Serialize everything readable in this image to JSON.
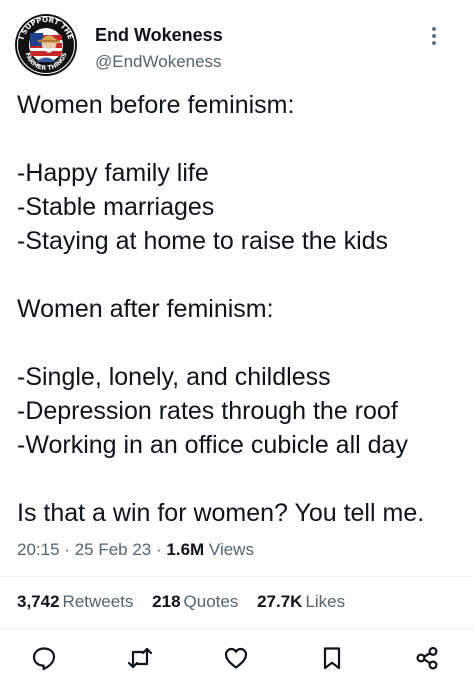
{
  "author": {
    "display_name": "End Wokeness",
    "handle": "@EndWokeness",
    "avatar": {
      "icon": "support-farmer-badge-icon",
      "badge_text_top": "I SUPPORT THE",
      "badge_text_bottom": "FARMER THINGS"
    }
  },
  "tweet": {
    "lines": [
      "Women before feminism:",
      "",
      "-Happy family life",
      "-Stable marriages",
      "-Staying at home to raise the kids",
      "",
      "Women after feminism:",
      "",
      "-Single, lonely, and childless",
      "-Depression rates through the roof",
      "-Working in an office cubicle all day",
      "",
      "Is that a win for women? You tell me."
    ]
  },
  "meta": {
    "time": "20:15",
    "date": "25 Feb 23",
    "views_count": "1.6M",
    "views_label": "Views",
    "separator": "·"
  },
  "stats": {
    "retweets_count": "3,742",
    "retweets_label": "Retweets",
    "quotes_count": "218",
    "quotes_label": "Quotes",
    "likes_count": "27.7K",
    "likes_label": "Likes"
  },
  "actions": [
    {
      "name": "reply",
      "icon": "reply-icon"
    },
    {
      "name": "retweet",
      "icon": "retweet-icon"
    },
    {
      "name": "like",
      "icon": "heart-icon"
    },
    {
      "name": "bookmark",
      "icon": "bookmark-icon"
    },
    {
      "name": "share",
      "icon": "share-icon"
    }
  ],
  "colors": {
    "text_primary": "#0f1419",
    "text_secondary": "#536471",
    "divider": "#eff3f4",
    "background": "#ffffff"
  }
}
